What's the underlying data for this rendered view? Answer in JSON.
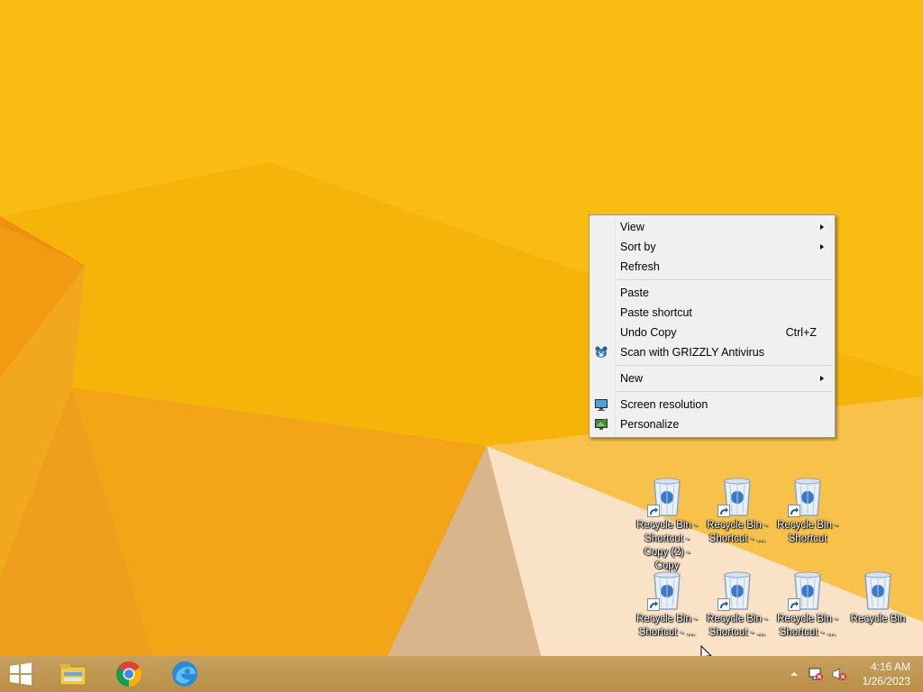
{
  "context_menu": {
    "items": [
      {
        "label": "View",
        "submenu": true
      },
      {
        "label": "Sort by",
        "submenu": true
      },
      {
        "label": "Refresh"
      },
      {
        "label": "Paste"
      },
      {
        "label": "Paste shortcut"
      },
      {
        "label": "Undo Copy",
        "shortcut": "Ctrl+Z"
      },
      {
        "label": "Scan with GRIZZLY Antivirus",
        "icon": "grizzly-antivirus-icon"
      },
      {
        "label": "New",
        "submenu": true
      },
      {
        "label": "Screen resolution",
        "icon": "screen-resolution-icon"
      },
      {
        "label": "Personalize",
        "icon": "personalize-icon"
      }
    ]
  },
  "desktop_icons": [
    {
      "label": "Recycle Bin - Shortcut - Copy (2) - Copy",
      "icon": "recycle-bin-icon",
      "shortcut": true
    },
    {
      "label": "Recycle Bin - Shortcut - ...",
      "icon": "recycle-bin-icon",
      "shortcut": true
    },
    {
      "label": "Recycle Bin - Shortcut",
      "icon": "recycle-bin-icon",
      "shortcut": true
    },
    {
      "label": "Recycle Bin - Shortcut - ...",
      "icon": "recycle-bin-icon",
      "shortcut": true
    },
    {
      "label": "Recycle Bin - Shortcut - ...",
      "icon": "recycle-bin-icon",
      "shortcut": true
    },
    {
      "label": "Recycle Bin - Shortcut - ...",
      "icon": "recycle-bin-icon",
      "shortcut": true
    },
    {
      "label": "Recycle Bin",
      "icon": "recycle-bin-icon",
      "shortcut": false
    }
  ],
  "taskbar": {
    "pinned": [
      {
        "name": "start",
        "icon": "windows-logo-icon"
      },
      {
        "name": "file-explorer",
        "icon": "file-explorer-icon"
      },
      {
        "name": "chrome",
        "icon": "chrome-icon"
      },
      {
        "name": "edge",
        "icon": "edge-icon"
      }
    ],
    "tray_icons": [
      "show-hidden-icons-icon",
      "network-disconnected-icon",
      "volume-muted-icon"
    ],
    "clock": {
      "time": "4:16 AM",
      "date": "1/26/2023"
    }
  },
  "colors": {
    "wallpaper": "#f6b40b",
    "taskbar": "#bf9450",
    "menu_background": "#f0f0f0"
  }
}
